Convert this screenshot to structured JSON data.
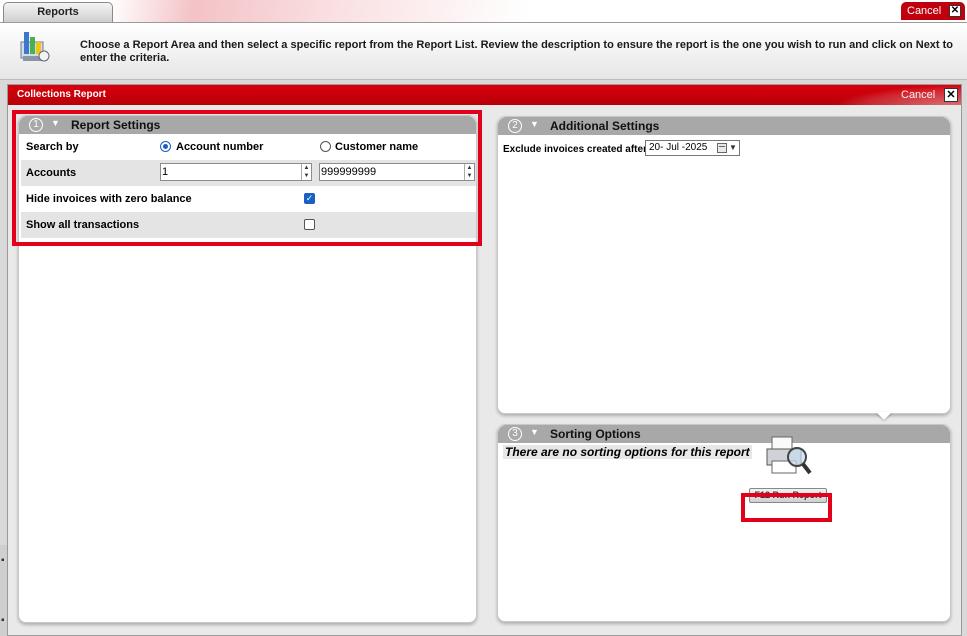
{
  "top": {
    "tab_label": "Reports",
    "cancel_label": "Cancel",
    "close_glyph": "✕"
  },
  "instructions": {
    "text": "Choose a Report Area and then select a specific report from the Report List. Review the description to ensure the report is the one you wish to run and click on Next to enter the criteria.",
    "icon": "reports-chart-icon"
  },
  "window": {
    "title": "Collections Report",
    "cancel_label": "Cancel",
    "close_glyph": "✕"
  },
  "report_settings": {
    "number": "1",
    "title": "Report Settings",
    "search_by_label": "Search by",
    "option_account": "Account number",
    "option_customer": "Customer name",
    "selected_option": "Account number",
    "accounts_label": "Accounts",
    "accounts_from": "1",
    "accounts_to": "999999999",
    "hide_zero_label": "Hide invoices with zero balance",
    "hide_zero_checked": true,
    "show_all_label": "Show all transactions",
    "show_all_checked": false
  },
  "additional_settings": {
    "number": "2",
    "title": "Additional Settings",
    "exclude_label": "Exclude invoices created after",
    "exclude_date": "20- Jul -2025"
  },
  "sorting_options": {
    "number": "3",
    "title": "Sorting Options",
    "empty_message": "There are no sorting options for this report",
    "run_button": "F12  Run Report"
  },
  "colors": {
    "accent_red": "#d8000d",
    "highlight_frame": "#e3001b",
    "panel_header": "#a8a8a8",
    "selected_blue": "#1a5fc4"
  }
}
